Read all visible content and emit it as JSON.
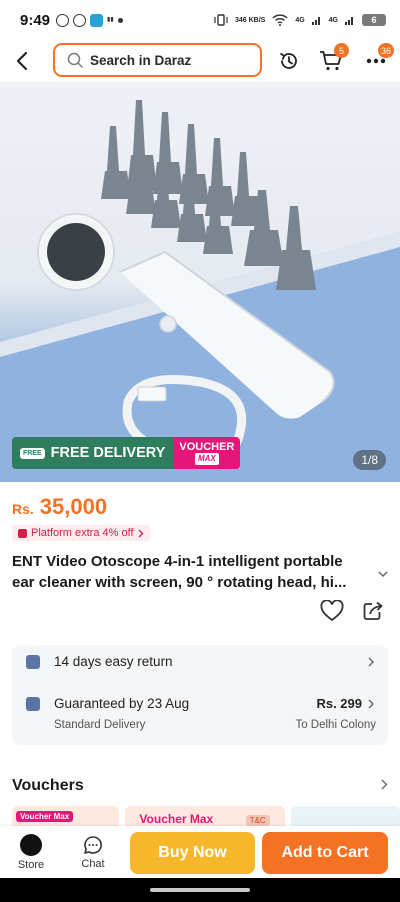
{
  "status_bar": {
    "time": "9:49",
    "speed_label": "346 KB/S",
    "network_label_1": "4G",
    "network_label_2": "4G",
    "battery": "6"
  },
  "header": {
    "search_placeholder": "Search in Daraz",
    "cart_badge": "5",
    "more_badge": "36"
  },
  "product": {
    "image_counter": "1/8",
    "delivery_badge": "FREE DELIVERY",
    "free_tag": "FREE",
    "voucher_badge": "VOUCHER",
    "voucher_badge_max": "MAX",
    "currency": "Rs.",
    "price": "35,000",
    "platform_offer": "Platform extra 4% off",
    "title": "ENT Video Otoscope 4-in-1 intelligent portable ear cleaner with screen, 90 ° rotating head, hi..."
  },
  "delivery": {
    "return_text": "14 days easy return",
    "guarantee_text": "Guaranteed by 23 Aug",
    "delivery_fee": "Rs. 299",
    "delivery_type": "Standard Delivery",
    "destination": "To Delhi Colony"
  },
  "vouchers": {
    "title": "Vouchers",
    "card1_tag": "Voucher Max",
    "card2_text": "Voucher Max",
    "card2_tag": "T&C"
  },
  "bottom_bar": {
    "store_label": "Store",
    "chat_label": "Chat",
    "buy_now": "Buy Now",
    "add_to_cart": "Add to Cart"
  },
  "colors": {
    "accent": "#f57224",
    "buy_now": "#f8b72a",
    "delivery_green": "#2e7d5c",
    "voucher_pink": "#e6157a"
  }
}
